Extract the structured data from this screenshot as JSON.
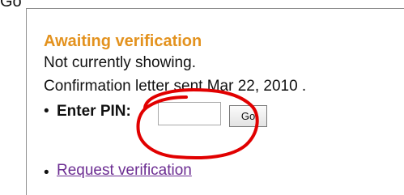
{
  "top": {
    "partial_text": "Go"
  },
  "verification": {
    "heading": "Awaiting verification",
    "status_text": "Not currently showing.",
    "confirmation_text": "Confirmation letter sent Mar 22, 2010 .",
    "bullet": "•",
    "pin_label": "Enter PIN:",
    "pin_value": "",
    "go_label": "Go",
    "request_link": "Request verification"
  },
  "annotation": {
    "circle_color": "#e10000"
  }
}
